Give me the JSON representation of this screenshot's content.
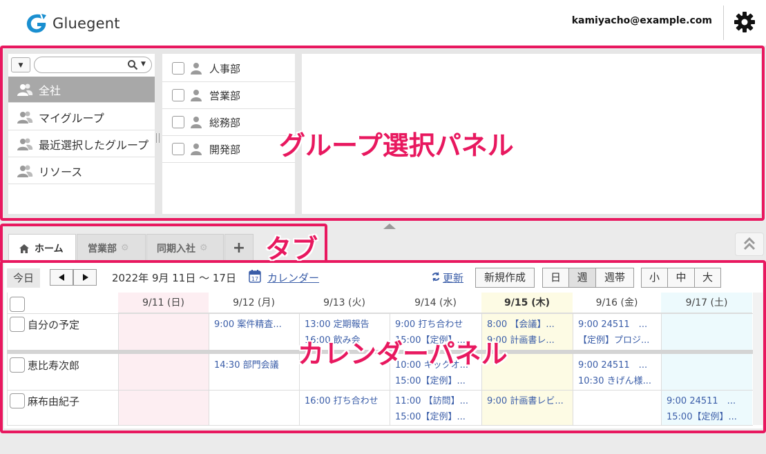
{
  "header": {
    "app_name": "Gluegent",
    "user_email": "kamiyacho@example.com",
    "brand_color": "#1a8fd0"
  },
  "group_panel": {
    "annotation": "グループ選択パネル",
    "search": {
      "placeholder": "",
      "value": ""
    },
    "categories": [
      {
        "label": "全社",
        "icon": "group-icon",
        "selected": true
      },
      {
        "label": "マイグループ",
        "icon": "group-icon",
        "selected": false
      },
      {
        "label": "最近選択したグループ",
        "icon": "group-icon",
        "selected": false
      },
      {
        "label": "リソース",
        "icon": "group-icon",
        "selected": false
      }
    ],
    "departments": [
      {
        "label": "人事部",
        "checked": false
      },
      {
        "label": "営業部",
        "checked": false
      },
      {
        "label": "総務部",
        "checked": false
      },
      {
        "label": "開発部",
        "checked": false
      }
    ]
  },
  "tabs": {
    "annotation": "タブ",
    "items": [
      {
        "label": "ホーム",
        "icon": "home-icon",
        "active": true
      },
      {
        "label": "営業部",
        "icon": "gear-icon",
        "active": false
      },
      {
        "label": "同期入社",
        "icon": "gear-icon",
        "active": false
      }
    ],
    "add_label": "+"
  },
  "calendar": {
    "annotation": "カレンダーパネル",
    "toolbar": {
      "today": "今日",
      "range": "2022年 9月 11日 ～ 17日",
      "calendar_link": "カレンダー",
      "refresh": "更新",
      "new": "新規作成",
      "view_modes": [
        "日",
        "週",
        "週帯"
      ],
      "active_view": "週",
      "sizes": [
        "小",
        "中",
        "大"
      ]
    },
    "days": [
      {
        "label": "9/11 (日)",
        "kind": "sunday"
      },
      {
        "label": "9/12 (月)",
        "kind": "weekday"
      },
      {
        "label": "9/13 (火)",
        "kind": "weekday"
      },
      {
        "label": "9/14 (水)",
        "kind": "weekday"
      },
      {
        "label": "9/15 (木)",
        "kind": "today"
      },
      {
        "label": "9/16 (金)",
        "kind": "weekday"
      },
      {
        "label": "9/17 (土)",
        "kind": "saturday"
      }
    ],
    "rows": [
      {
        "name": "自分の予定",
        "events": [
          [],
          [
            "9:00 案件精査..."
          ],
          [
            "13:00 定期報告",
            "16:00 飲み会"
          ],
          [
            "9:00 打ち合わせ",
            "15:00【定例】..."
          ],
          [
            "8:00 【会議】...",
            "9:00 計画書レ..."
          ],
          [
            "9:00 24511　...",
            "【定例】プロジ..."
          ],
          []
        ]
      },
      {
        "name": "恵比寿次郎",
        "events": [
          [],
          [
            "14:30 部門会議"
          ],
          [],
          [
            "10:00 キックオ...",
            "15:00【定例】..."
          ],
          [],
          [
            "9:00 24511　...",
            "10:30 きげん様..."
          ],
          []
        ]
      },
      {
        "name": "麻布由紀子",
        "events": [
          [],
          [],
          [
            "16:00 打ち合わせ"
          ],
          [
            "11:00 【訪問】...",
            "15:00【定例】..."
          ],
          [
            "9:00 計画書レビ..."
          ],
          [],
          [
            "9:00 24511　...",
            "15:00【定例】..."
          ]
        ]
      }
    ]
  },
  "colors": {
    "annotation": "#e8185f",
    "link": "#3a5da8",
    "sunday_bg": "#fdeef2",
    "today_bg": "#fdfbe4",
    "saturday_bg": "#edfafd"
  }
}
